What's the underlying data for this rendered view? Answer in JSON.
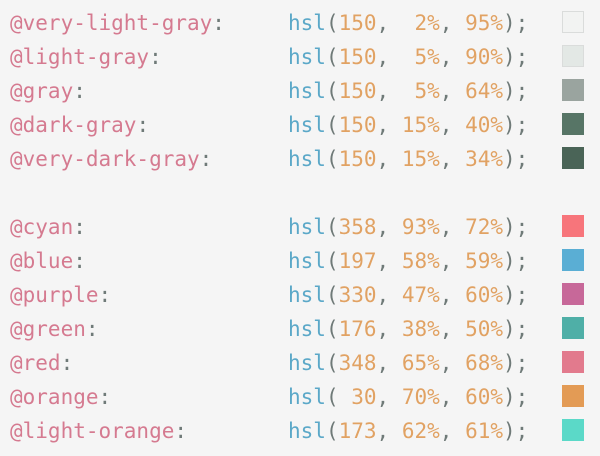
{
  "group1": [
    {
      "name": "@very-light-gray",
      "func": "hsl",
      "h": "150",
      "s": " 2%",
      "l": "95%",
      "color": "#f2f3f2"
    },
    {
      "name": "@light-gray",
      "func": "hsl",
      "h": "150",
      "s": " 5%",
      "l": "90%",
      "color": "#e3e8e5"
    },
    {
      "name": "@gray",
      "func": "hsl",
      "h": "150",
      "s": " 5%",
      "l": "64%",
      "color": "#9aa49f"
    },
    {
      "name": "@dark-gray",
      "func": "hsl",
      "h": "150",
      "s": "15%",
      "l": "40%",
      "color": "#577566"
    },
    {
      "name": "@very-dark-gray",
      "func": "hsl",
      "h": "150",
      "s": "15%",
      "l": "34%",
      "color": "#4a6457"
    }
  ],
  "group2": [
    {
      "name": "@cyan",
      "func": "hsl",
      "h": "358",
      "s": "93%",
      "l": "72%",
      "color": "#f7757b"
    },
    {
      "name": "@blue",
      "func": "hsl",
      "h": "197",
      "s": "58%",
      "l": "59%",
      "color": "#5aaed4"
    },
    {
      "name": "@purple",
      "func": "hsl",
      "h": "330",
      "s": "47%",
      "l": "60%",
      "color": "#c76899"
    },
    {
      "name": "@green",
      "func": "hsl",
      "h": "176",
      "s": "38%",
      "l": "50%",
      "color": "#4fafa7"
    },
    {
      "name": "@red",
      "func": "hsl",
      "h": "348",
      "s": "65%",
      "l": "68%",
      "color": "#e27a8d"
    },
    {
      "name": "@orange",
      "func": "hsl",
      "h": " 30",
      "s": "70%",
      "l": "60%",
      "color": "#e39b55"
    },
    {
      "name": "@light-orange",
      "func": "hsl",
      "h": "173",
      "s": "62%",
      "l": "61%",
      "color": "#5bd9c8"
    }
  ]
}
